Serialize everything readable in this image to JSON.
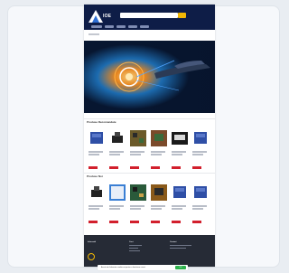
{
  "site": {
    "logo_text": "IOE",
    "top_links": [
      "",
      ""
    ],
    "search_placeholder": "",
    "nav": [
      "",
      "",
      "",
      "",
      ""
    ]
  },
  "sections": [
    {
      "title": "Produse Recomandate",
      "products": [
        {
          "icon": "box-icon",
          "color": "#2f4fa6"
        },
        {
          "icon": "printer-icon",
          "color": "#222222"
        },
        {
          "icon": "pcb-icon",
          "color": "#6b5a2a"
        },
        {
          "icon": "pcb-icon",
          "color": "#7a4a2a"
        },
        {
          "icon": "device-icon",
          "color": "#1a1a1a"
        },
        {
          "icon": "box-icon",
          "color": "#2f4fa6"
        }
      ]
    },
    {
      "title": "Produse Noi",
      "products": [
        {
          "icon": "printer-icon",
          "color": "#222222"
        },
        {
          "icon": "screen-icon",
          "color": "#3a7fd4"
        },
        {
          "icon": "pcb-icon",
          "color": "#2a5a3a"
        },
        {
          "icon": "pcb-icon",
          "color": "#8a5a1a"
        },
        {
          "icon": "box-icon",
          "color": "#2f4fa6"
        },
        {
          "icon": "box-icon",
          "color": "#2f4fa6"
        }
      ]
    }
  ],
  "footer": {
    "columns": [
      {
        "heading": "Informatii"
      },
      {
        "heading": "Cont"
      },
      {
        "heading": "Contact"
      }
    ],
    "badge_text": ""
  },
  "cookie": {
    "text": "Acest site foloseste cookie-uri pentru a functiona corect",
    "button": "OK"
  },
  "colors": {
    "header": "#0e1d47",
    "accent": "#f2b705",
    "price": "#d21f2c",
    "footer": "#262b36",
    "cookie_button": "#2db24c"
  }
}
